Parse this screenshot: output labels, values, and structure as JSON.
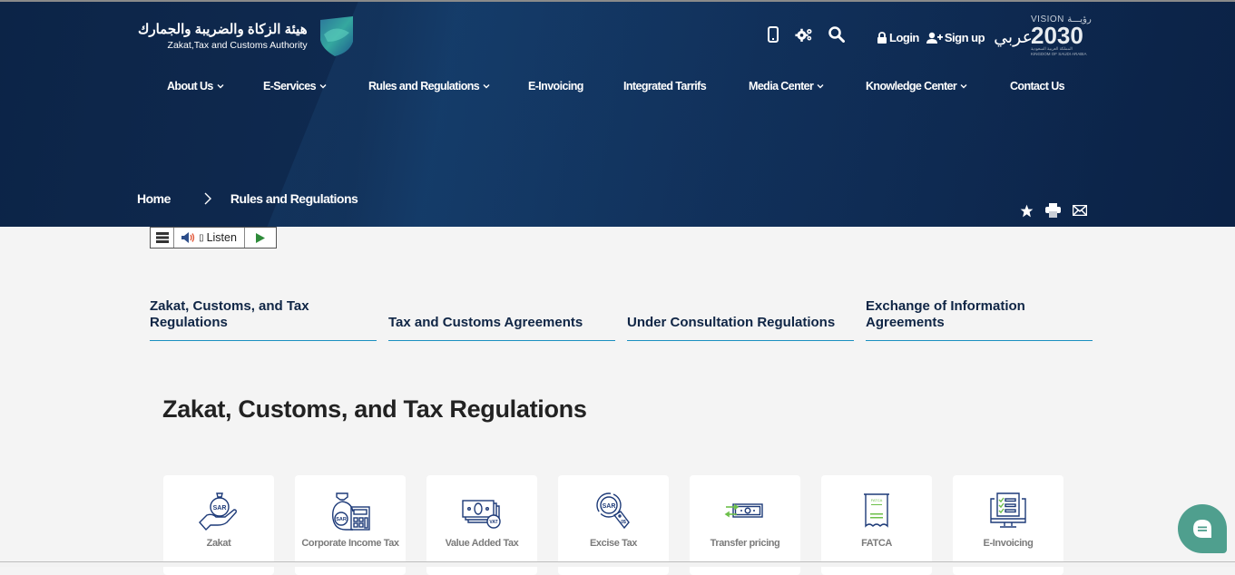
{
  "header": {
    "logo": {
      "arabic_name": "هيئة الزكاة والضريبة والجمارك",
      "english_name": "Zakat,Tax and Customs Authority"
    },
    "icons": [
      "mobile-icon",
      "settings-icon",
      "search-icon"
    ],
    "login_label": "Login",
    "signup_label": "Sign up",
    "language_label": "عربي",
    "vision": {
      "top": "VISION رؤيـــة",
      "year": "2030",
      "arabic": "المملكة العربية السعودية",
      "english": "KINGDOM OF SAUDI ARABIA"
    }
  },
  "nav": {
    "items": [
      {
        "label": "About Us",
        "has_dropdown": true
      },
      {
        "label": "E-Services",
        "has_dropdown": true
      },
      {
        "label": "Rules and Regulations",
        "has_dropdown": true
      },
      {
        "label": "E-Invoicing",
        "has_dropdown": false
      },
      {
        "label": "Integrated Tarrifs",
        "has_dropdown": false
      },
      {
        "label": "Media Center",
        "has_dropdown": true
      },
      {
        "label": "Knowledge Center",
        "has_dropdown": true
      },
      {
        "label": "Contact Us",
        "has_dropdown": false
      }
    ]
  },
  "breadcrumb": {
    "items": [
      "Home",
      "Rules and Regulations"
    ]
  },
  "page_actions": [
    "star-icon",
    "print-icon",
    "email-icon"
  ],
  "listen_bar": {
    "label": "Listen",
    "glyph": "▯"
  },
  "tabs": [
    {
      "label": "Zakat, Customs, and Tax Regulations"
    },
    {
      "label": "Tax and Customs Agreements"
    },
    {
      "label": "Under Consultation Regulations"
    },
    {
      "label": "Exchange of Information Agreements"
    }
  ],
  "section": {
    "title": "Zakat, Customs, and Tax Regulations"
  },
  "cards": [
    {
      "label": "Zakat",
      "icon": "zakat-icon"
    },
    {
      "label": "Corporate Income Tax",
      "icon": "corporate-tax-icon"
    },
    {
      "label": "Value Added Tax",
      "icon": "vat-icon"
    },
    {
      "label": "Excise Tax",
      "icon": "excise-tax-icon"
    },
    {
      "label": "Transfer pricing",
      "icon": "transfer-pricing-icon"
    },
    {
      "label": "FATCA",
      "icon": "fatca-icon"
    },
    {
      "label": "E-Invoicing",
      "icon": "e-invoicing-icon"
    }
  ],
  "colors": {
    "hero_bg": "#0c2447",
    "tab_underline": "#1a8fc0",
    "icon_blue": "#1d3a78",
    "icon_green": "#6cbf4a",
    "chat_bg": "#4f9f8e",
    "card_label": "#7b7b7b"
  }
}
